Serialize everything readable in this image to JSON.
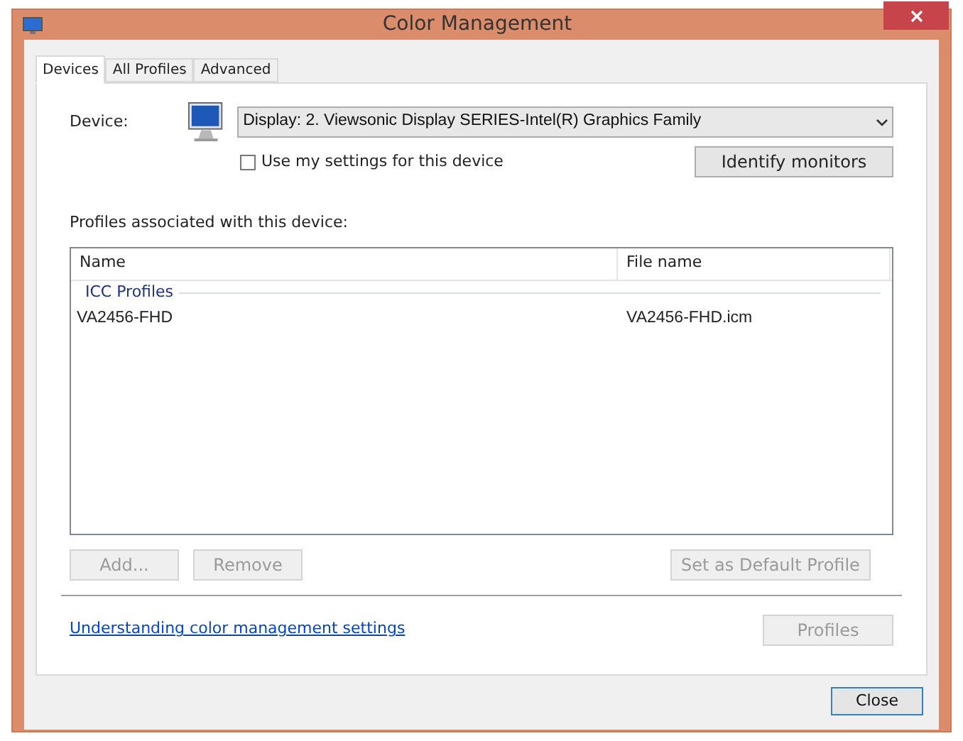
{
  "window": {
    "title": "Color Management"
  },
  "tabs": [
    {
      "label": "Devices",
      "selected": true
    },
    {
      "label": "All Profiles",
      "selected": false
    },
    {
      "label": "Advanced",
      "selected": false
    }
  ],
  "device": {
    "label": "Device:",
    "value": "Display: 2. Viewsonic Display SERIES-Intel(R) Graphics Family"
  },
  "use_my_settings": {
    "label": "Use my settings for this device",
    "checked": false
  },
  "identify_button": {
    "label": "Identify monitors",
    "disabled": false
  },
  "profiles_label": "Profiles associated with this device:",
  "table": {
    "columns": [
      "Name",
      "File name"
    ],
    "groups": [
      {
        "label": "ICC Profiles",
        "rows": [
          {
            "name": "VA2456-FHD",
            "file": "VA2456-FHD.icm"
          }
        ]
      }
    ]
  },
  "profile_buttons": [
    {
      "label": "Add...",
      "disabled": true
    },
    {
      "label": "Remove",
      "disabled": true
    },
    {
      "label": "Set as Default Profile",
      "disabled": true
    }
  ],
  "link": "Understanding color management settings",
  "profiles_button": {
    "label": "Profiles",
    "disabled": true
  },
  "close_button": {
    "label": "Close"
  }
}
